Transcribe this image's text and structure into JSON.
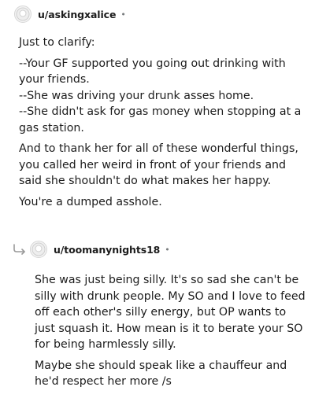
{
  "comment1": {
    "username": "u/askingxalice",
    "separator": "•",
    "avatar_icon": "default-avatar-icon",
    "paragraphs": [
      "Just to clarify:",
      "--Your GF supported you going out drinking with your friends.\n--She was driving your drunk asses home.\n--She didn't ask for gas money when stopping at a gas station.",
      "And to thank her for all of these wonderful things, you called her weird in front of your friends and said she shouldn't do what makes her happy.",
      "You're a dumped asshole."
    ]
  },
  "comment2": {
    "username": "u/toomanynights18",
    "separator": "•",
    "avatar_icon": "default-avatar-icon",
    "reply_icon": "reply-arrow-icon",
    "paragraphs": [
      "She was just being silly. It's so sad she can't be silly with drunk people. My SO and I love to feed off each other's silly energy, but OP wants to just squash it. How mean is it to berate your SO for being harmlessly silly.",
      "Maybe she should speak like a chauffeur and he'd respect her more /s"
    ]
  },
  "colors": {
    "text": "#1c1c1c",
    "meta": "#787c7e",
    "avatar_border": "#d6d6d6",
    "reply_icon": "#9a9a9a"
  }
}
